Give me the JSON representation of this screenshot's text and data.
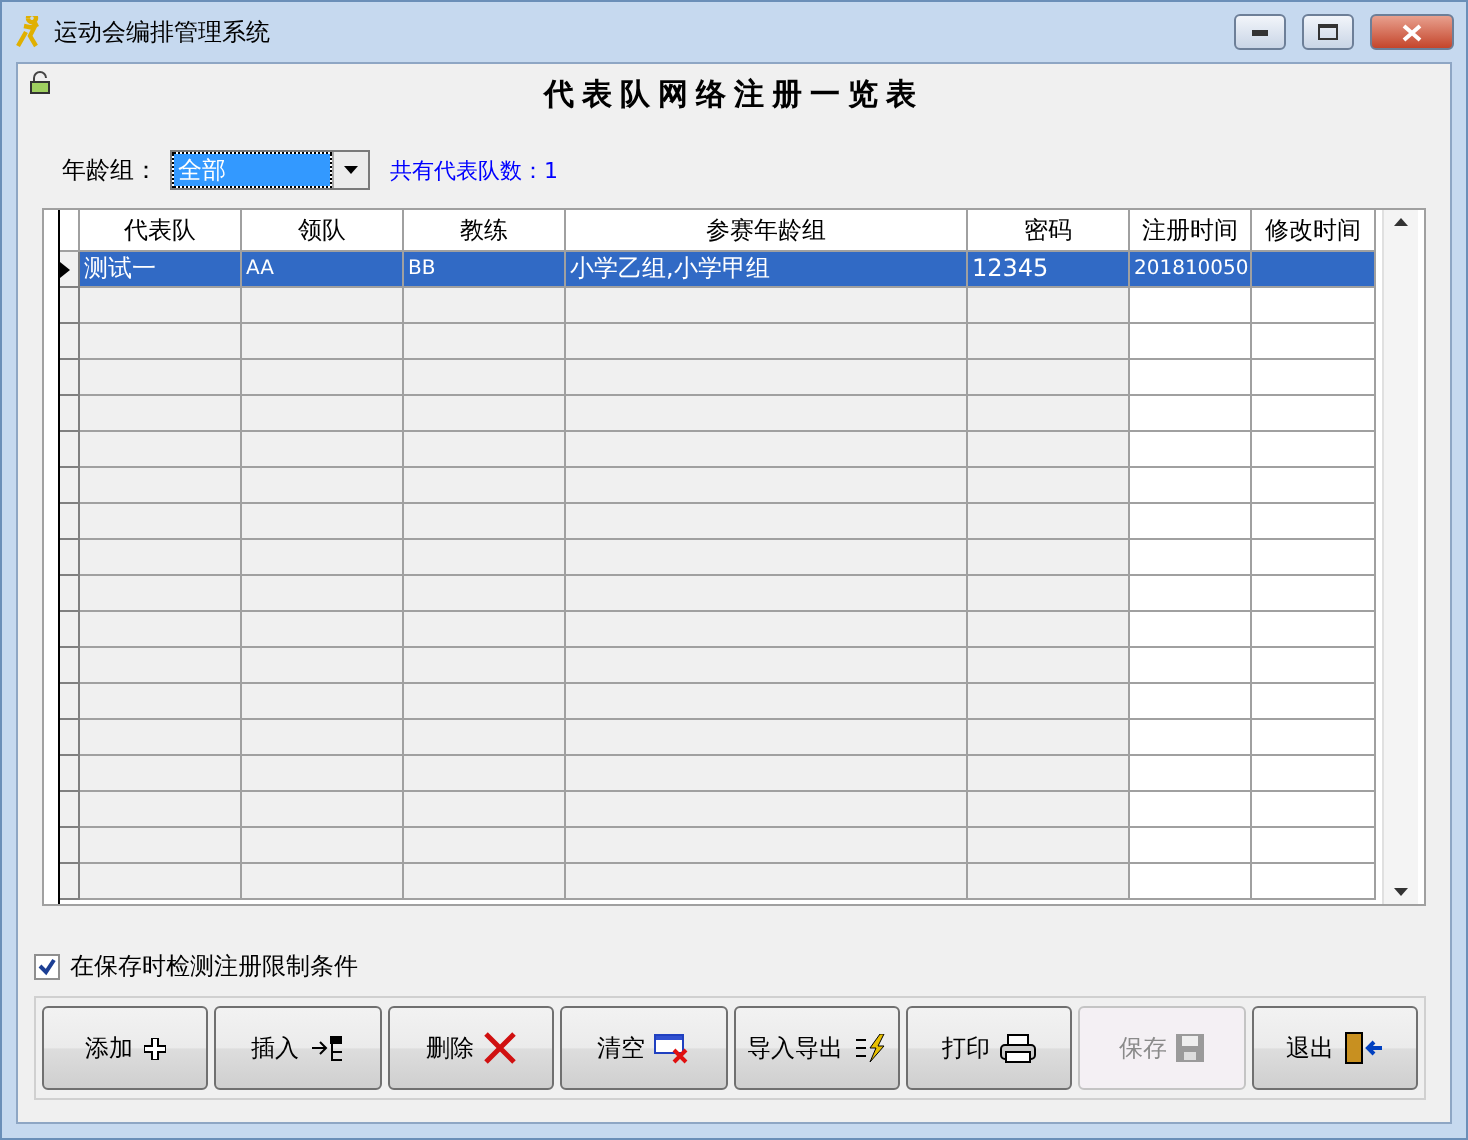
{
  "window": {
    "title": "运动会编排管理系统"
  },
  "heading": "代表队网络注册一览表",
  "filter": {
    "label": "年龄组：",
    "value": "全部"
  },
  "count_label": "共有代表队数：1",
  "table": {
    "columns": [
      "代表队",
      "领队",
      "教练",
      "参赛年龄组",
      "密码",
      "注册时间",
      "修改时间"
    ],
    "rows": [
      {
        "selected": true,
        "cells": [
          "测试一",
          "AA",
          "BB",
          "小学乙组,小学甲组",
          "12345",
          "201810050",
          ""
        ]
      }
    ]
  },
  "check_on_save": {
    "label": "在保存时检测注册限制条件",
    "checked": true
  },
  "buttons": [
    {
      "label": "添加",
      "kind": "plus",
      "disabled": false
    },
    {
      "label": "插入",
      "kind": "insert",
      "disabled": false
    },
    {
      "label": "删除",
      "kind": "delete",
      "disabled": false
    },
    {
      "label": "清空",
      "kind": "clear",
      "disabled": false
    },
    {
      "label": "导入导出",
      "kind": "import",
      "disabled": false
    },
    {
      "label": "打印",
      "kind": "print",
      "disabled": false
    },
    {
      "label": "保存",
      "kind": "save",
      "disabled": true
    },
    {
      "label": "退出",
      "kind": "exit",
      "disabled": false
    }
  ]
}
